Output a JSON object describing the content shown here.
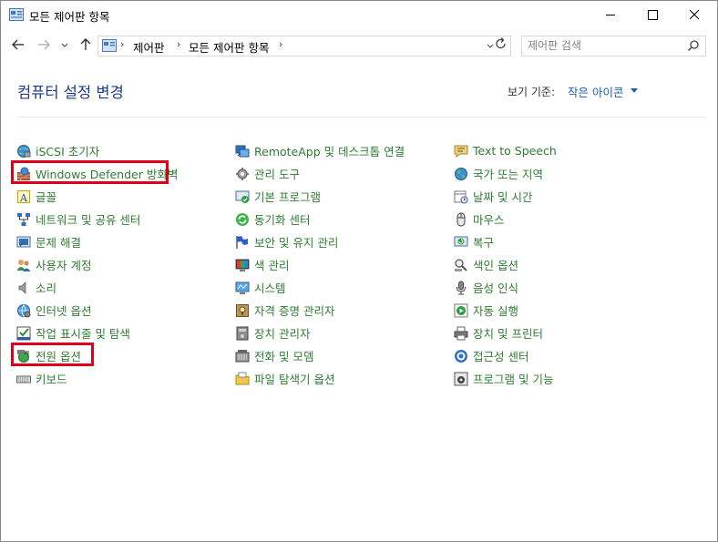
{
  "window": {
    "title": "모든 제어판 항목",
    "controls": [
      "minimize",
      "maximize",
      "close"
    ]
  },
  "navigation": {
    "back": "back-arrow",
    "forward": "forward-arrow",
    "recent": "chevron-down",
    "up": "up-arrow",
    "breadcrumbs": [
      "제어판",
      "모든 제어판 항목"
    ],
    "search_placeholder": "제어판 검색"
  },
  "header": {
    "title": "컴퓨터 설정 변경",
    "view_by_label": "보기 기준:",
    "view_by_value": "작은 아이콘"
  },
  "items": {
    "col1": [
      {
        "label": "iSCSI 초기자",
        "icon": "globe-network-icon"
      },
      {
        "label": "Windows Defender 방화벽",
        "icon": "firewall-icon",
        "highlighted": true
      },
      {
        "label": "글꼴",
        "icon": "font-icon"
      },
      {
        "label": "네트워크 및 공유 센터",
        "icon": "network-icon"
      },
      {
        "label": "문제 해결",
        "icon": "troubleshoot-icon"
      },
      {
        "label": "사용자 계정",
        "icon": "users-icon"
      },
      {
        "label": "소리",
        "icon": "speaker-icon"
      },
      {
        "label": "인터넷 옵션",
        "icon": "internet-icon"
      },
      {
        "label": "작업 표시줄 및 탐색",
        "icon": "taskbar-icon"
      },
      {
        "label": "전원 옵션",
        "icon": "power-icon",
        "highlighted": true
      },
      {
        "label": "키보드",
        "icon": "keyboard-icon"
      }
    ],
    "col2": [
      {
        "label": "RemoteApp 및 데스크톱 연결",
        "icon": "remote-desktop-icon"
      },
      {
        "label": "관리 도구",
        "icon": "tools-icon"
      },
      {
        "label": "기본 프로그램",
        "icon": "default-programs-icon"
      },
      {
        "label": "동기화 센터",
        "icon": "sync-icon"
      },
      {
        "label": "보안 및 유지 관리",
        "icon": "flag-icon"
      },
      {
        "label": "색 관리",
        "icon": "color-icon"
      },
      {
        "label": "시스템",
        "icon": "system-icon"
      },
      {
        "label": "자격 증명 관리자",
        "icon": "credential-icon"
      },
      {
        "label": "장치 관리자",
        "icon": "device-manager-icon"
      },
      {
        "label": "전화 및 모뎀",
        "icon": "phone-icon"
      },
      {
        "label": "파일 탐색기 옵션",
        "icon": "folder-options-icon"
      }
    ],
    "col3": [
      {
        "label": "Text to Speech",
        "icon": "speech-icon"
      },
      {
        "label": "국가 또는 지역",
        "icon": "region-icon"
      },
      {
        "label": "날짜 및 시간",
        "icon": "clock-icon"
      },
      {
        "label": "마우스",
        "icon": "mouse-icon"
      },
      {
        "label": "복구",
        "icon": "recovery-icon"
      },
      {
        "label": "색인 옵션",
        "icon": "indexing-icon"
      },
      {
        "label": "음성 인식",
        "icon": "microphone-icon"
      },
      {
        "label": "자동 실행",
        "icon": "autoplay-icon"
      },
      {
        "label": "장치 및 프린터",
        "icon": "printer-icon"
      },
      {
        "label": "접근성 센터",
        "icon": "accessibility-icon"
      },
      {
        "label": "프로그램 및 기능",
        "icon": "programs-icon"
      }
    ]
  },
  "colors": {
    "link_green": "#2e7d32",
    "title_blue": "#1e3a8a",
    "accent_blue": "#1a5fb4",
    "highlight_red": "#e0001b"
  }
}
